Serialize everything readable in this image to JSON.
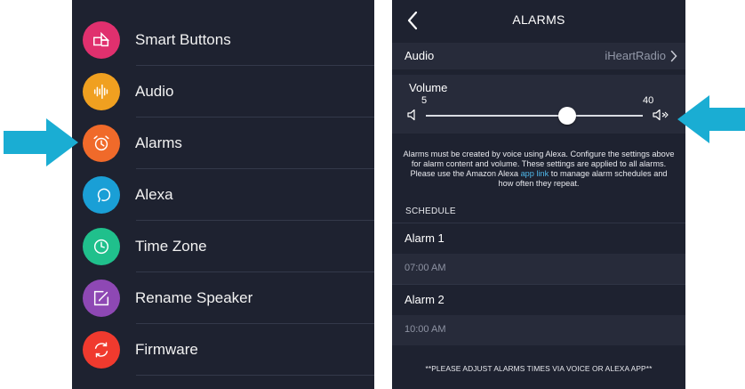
{
  "colors": {
    "panel_bg": "#1e2230",
    "arrow": "#1aadd3",
    "link": "#4fb6e8"
  },
  "menu": {
    "items": [
      {
        "label": "Smart Buttons",
        "icon": "shapes-icon",
        "color": "#e0306e"
      },
      {
        "label": "Audio",
        "icon": "waveform-icon",
        "color": "#f0a020"
      },
      {
        "label": "Alarms",
        "icon": "alarm-clock-icon",
        "color": "#f06a2a"
      },
      {
        "label": "Alexa",
        "icon": "alexa-icon",
        "color": "#1a9fd6"
      },
      {
        "label": "Time Zone",
        "icon": "clock-icon",
        "color": "#20c08c"
      },
      {
        "label": "Rename Speaker",
        "icon": "edit-icon",
        "color": "#8e48b4"
      },
      {
        "label": "Firmware",
        "icon": "refresh-icon",
        "color": "#f03a2e"
      }
    ]
  },
  "alarms_screen": {
    "title": "ALARMS",
    "audio": {
      "label": "Audio",
      "value": "iHeartRadio"
    },
    "volume": {
      "label": "Volume",
      "min": "5",
      "max": "40",
      "level": 0.65
    },
    "info": {
      "text_before": "Alarms must be created by voice using Alexa. Configure the settings above for alarm content and volume. These settings are applied to all alarms. Please use the Amazon Alexa ",
      "link": "app link",
      "text_after": " to manage alarm schedules and how often they repeat."
    },
    "schedule_header": "SCHEDULE",
    "alarms": [
      {
        "name": "Alarm 1",
        "time": "07:00 AM"
      },
      {
        "name": "Alarm 2",
        "time": "10:00 AM"
      }
    ],
    "footnote": "**PLEASE ADJUST ALARMS TIMES VIA VOICE OR ALEXA APP**"
  }
}
